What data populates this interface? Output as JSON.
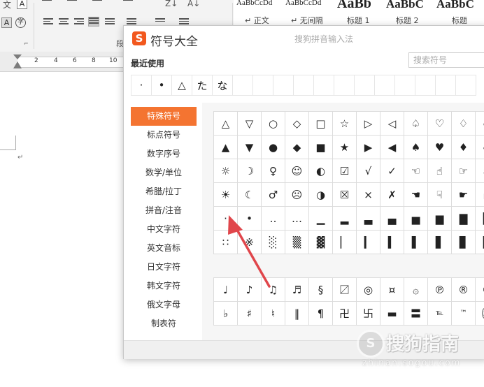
{
  "ribbon": {
    "row1_glyphs": [
      "文",
      "A",
      "A",
      "Z↓",
      "A↓"
    ],
    "row2_glyphs": [
      "A",
      "字"
    ],
    "paragraph_group_label": "段",
    "style_gallery": [
      {
        "sample": "AaBbCcDd",
        "name": "↵ 正文"
      },
      {
        "sample": "AaBbCcDd",
        "name": "↵ 无间隔"
      },
      {
        "sample": "AaBb",
        "name": "标题 1"
      },
      {
        "sample": "AaBbC",
        "name": "标题 2"
      },
      {
        "sample": "AaBbC",
        "name": "标题"
      }
    ]
  },
  "ruler": {
    "numbers": [
      "2",
      "4",
      "6",
      "8",
      "10"
    ]
  },
  "document": {
    "paragraph_mark": "↵"
  },
  "dialog": {
    "logo_letter": "S",
    "title": "符号大全",
    "subtitle": "搜狗拼音输入法",
    "recent_label": "最近使用",
    "search_placeholder": "搜索符号",
    "recent_symbols": [
      "·",
      "•",
      "△",
      "た",
      "な",
      "",
      "",
      "",
      "",
      "",
      "",
      "",
      "",
      "",
      "",
      "",
      ""
    ],
    "categories": [
      "特殊符号",
      "标点符号",
      "数字序号",
      "数学/单位",
      "希腊/拉丁",
      "拼音/注音",
      "中文字符",
      "英文音标",
      "日文字符",
      "韩文字符",
      "俄文字母",
      "制表符"
    ],
    "active_category": "特殊符号",
    "grid_top": [
      [
        "△",
        "▽",
        "○",
        "◇",
        "□",
        "☆",
        "▷",
        "◁",
        "♤",
        "♡",
        "♢",
        "♧"
      ],
      [
        "▲",
        "▼",
        "●",
        "◆",
        "■",
        "★",
        "▶",
        "◀",
        "♠",
        "♥",
        "♦",
        "♣"
      ],
      [
        "☼",
        "☽",
        "♀",
        "☺",
        "◐",
        "☑",
        "√",
        "✓",
        "☜",
        "☝",
        "☞",
        "㏂"
      ],
      [
        "☀",
        "☾",
        "♂",
        "☹",
        "◑",
        "☒",
        "×",
        "✗",
        "☚",
        "☟",
        "☛",
        "㏘"
      ],
      [
        "·",
        "•",
        "‥",
        "…",
        "▁",
        "▂",
        "▃",
        "▄",
        "▅",
        "▆",
        "▇",
        "█"
      ],
      [
        "∷",
        "※",
        "░",
        "▒",
        "▓",
        "▏",
        "▎",
        "▍",
        "▌",
        "▋",
        "▊",
        "▉"
      ]
    ],
    "grid_bottom": [
      [
        "♩",
        "♪",
        "♫",
        "♬",
        "§",
        "〼",
        "◎",
        "¤",
        "۞",
        "℗",
        "®",
        "©"
      ],
      [
        "♭",
        "♯",
        "♮",
        "‖",
        "¶",
        "卍",
        "卐",
        "▬",
        "〓",
        "℡",
        "™",
        "㈱"
      ]
    ]
  },
  "watermark": {
    "logo_letter": "S",
    "text": "搜狗指南",
    "url": "zhinan.sogou.com"
  },
  "annotation": {
    "arrow_color": "#e0464b"
  }
}
